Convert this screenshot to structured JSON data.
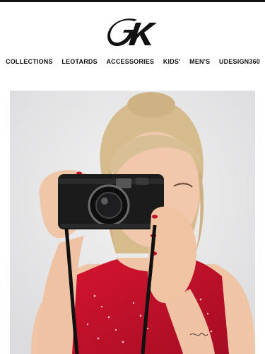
{
  "brand": {
    "logo_text": "GK",
    "logo_color": "#111111"
  },
  "nav": {
    "items": [
      {
        "label": "COLLECTIONS"
      },
      {
        "label": "LEOTARDS"
      },
      {
        "label": "ACCESSORIES"
      },
      {
        "label": "KIDS'"
      },
      {
        "label": "MEN'S"
      },
      {
        "label": "UDESIGN360"
      }
    ]
  },
  "hero": {
    "colors": {
      "backdrop": "#e6e6e8",
      "leotard": "#c8102e",
      "camera": "#1a1a1a",
      "hair": "#d9bf95",
      "skin": "#f0c9ad"
    }
  }
}
